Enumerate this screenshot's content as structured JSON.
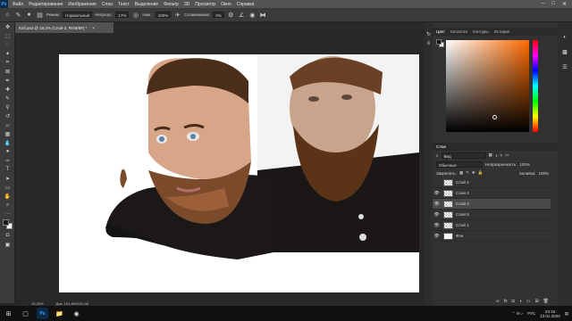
{
  "menubar": {
    "items": [
      "Файл",
      "Редактирование",
      "Изображение",
      "Слои",
      "Текст",
      "Выделение",
      "Фильтр",
      "3D",
      "Просмотр",
      "Окно",
      "Справка"
    ],
    "win_min": "–",
    "win_max": "□",
    "win_close": "✕"
  },
  "options": {
    "mode_label": "Режим:",
    "mode_value": "Нормальный",
    "opacity_label": "Непрозр.:",
    "opacity_value": "17%",
    "flow_label": "Наж.:",
    "flow_value": "100%",
    "smoothing_label": "Сглаживание:",
    "smoothing_value": "0%"
  },
  "document": {
    "tab_title": "Kirll.psd @ 19,2% (Слой 3, RGB/8#) *",
    "tab_close": "×",
    "zoom": "19,25%",
    "doc_size": "Док: 101,4М/203,1М"
  },
  "color_panel": {
    "tabs": [
      "Цвет",
      "Каталоги",
      "Контуры",
      "История"
    ]
  },
  "layers_panel": {
    "tabs": [
      "Слои"
    ],
    "kind_label": "Вид",
    "blend_mode": "Обычные",
    "opacity_label": "Непрозрачность:",
    "opacity_value": "100%",
    "lock_label": "Закрепить:",
    "fill_label": "Заливка:",
    "fill_value": "100%",
    "layers": [
      {
        "name": "Слой 2",
        "visible": false
      },
      {
        "name": "Слой 4",
        "visible": true
      },
      {
        "name": "Слой 3",
        "visible": true
      },
      {
        "name": "Слой 5",
        "visible": true
      },
      {
        "name": "Слой 1",
        "visible": true
      },
      {
        "name": "Фон",
        "visible": true
      }
    ]
  },
  "taskbar": {
    "lang": "РУС",
    "time": "23:15",
    "date": "13.01.2020"
  },
  "colors": {
    "accent": "#31a8ff",
    "ps_bg": "#0b2b48"
  }
}
